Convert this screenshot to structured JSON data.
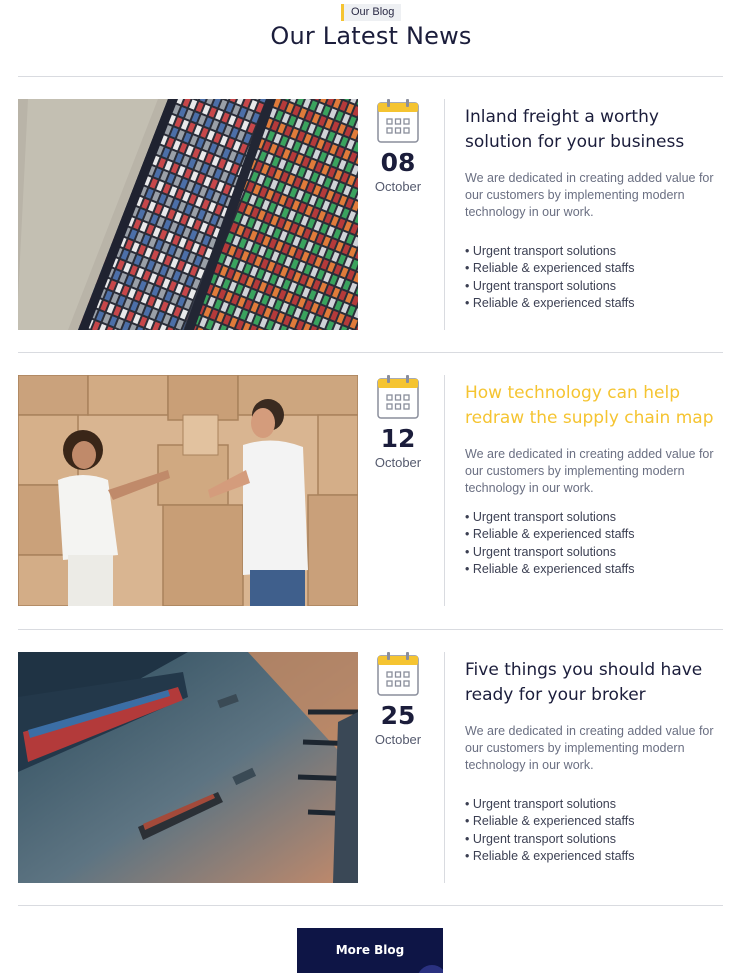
{
  "section": {
    "tag": "Our Blog",
    "title": "Our Latest News"
  },
  "posts": [
    {
      "day": "08",
      "month": "October",
      "title": "Inland freight a worthy solution for your business",
      "excerpt": "We are dedicated in creating added value for our customers by implementing modern technology in our work.",
      "features": [
        "• Urgent transport solutions",
        "• Reliable & experienced staffs",
        "• Urgent transport solutions",
        "• Reliable & experienced staffs"
      ],
      "image": "container-port-aerial"
    },
    {
      "day": "12",
      "month": "October",
      "title": "How technology can help redraw the supply chain map",
      "excerpt": "We are dedicated in creating added value for our customers by implementing modern technology in our work.",
      "features": [
        "• Urgent transport solutions",
        "• Reliable & experienced staffs",
        "• Urgent transport solutions",
        "• Reliable & experienced staffs"
      ],
      "image": "people-moving-boxes"
    },
    {
      "day": "25",
      "month": "October",
      "title": "Five things you should have ready for your broker",
      "excerpt": "We are dedicated in creating added value for our customers by implementing modern technology in our work.",
      "features": [
        "• Urgent transport solutions",
        "• Reliable & experienced staffs",
        "• Urgent transport solutions",
        "• Reliable & experienced staffs"
      ],
      "image": "cargo-ships-harbor"
    }
  ],
  "more_button": "More Blog",
  "colors": {
    "accent": "#f5c431",
    "navy": "#0e1546",
    "heading": "#1b1d3b",
    "muted": "#6a6f82"
  },
  "icons": {
    "date": "calendar-icon"
  }
}
